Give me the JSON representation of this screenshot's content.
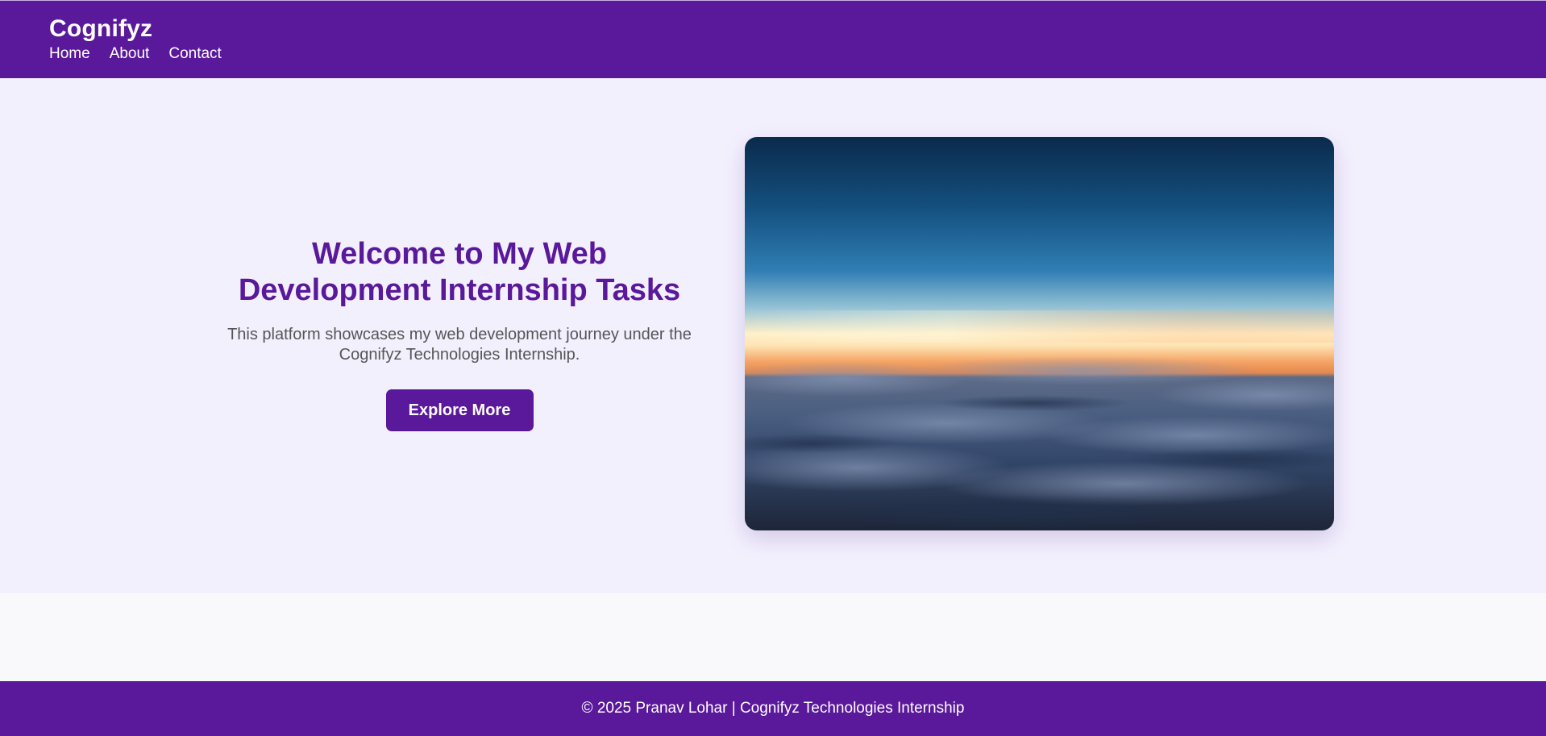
{
  "header": {
    "brand": "Cognifyz",
    "nav": [
      {
        "label": "Home"
      },
      {
        "label": "About"
      },
      {
        "label": "Contact"
      }
    ]
  },
  "hero": {
    "title": "Welcome to My Web Development Internship Tasks",
    "subtitle": "This platform showcases my web development journey under the Cognifyz Technologies Internship.",
    "cta_label": "Explore More"
  },
  "footer": {
    "text": "© 2025 Pranav Lohar | Cognifyz Technologies Internship"
  },
  "colors": {
    "brand": "#5a189a",
    "hero_background": "#f3f0fe",
    "page_background": "#f9f9fb",
    "subtitle_text": "#555555"
  }
}
